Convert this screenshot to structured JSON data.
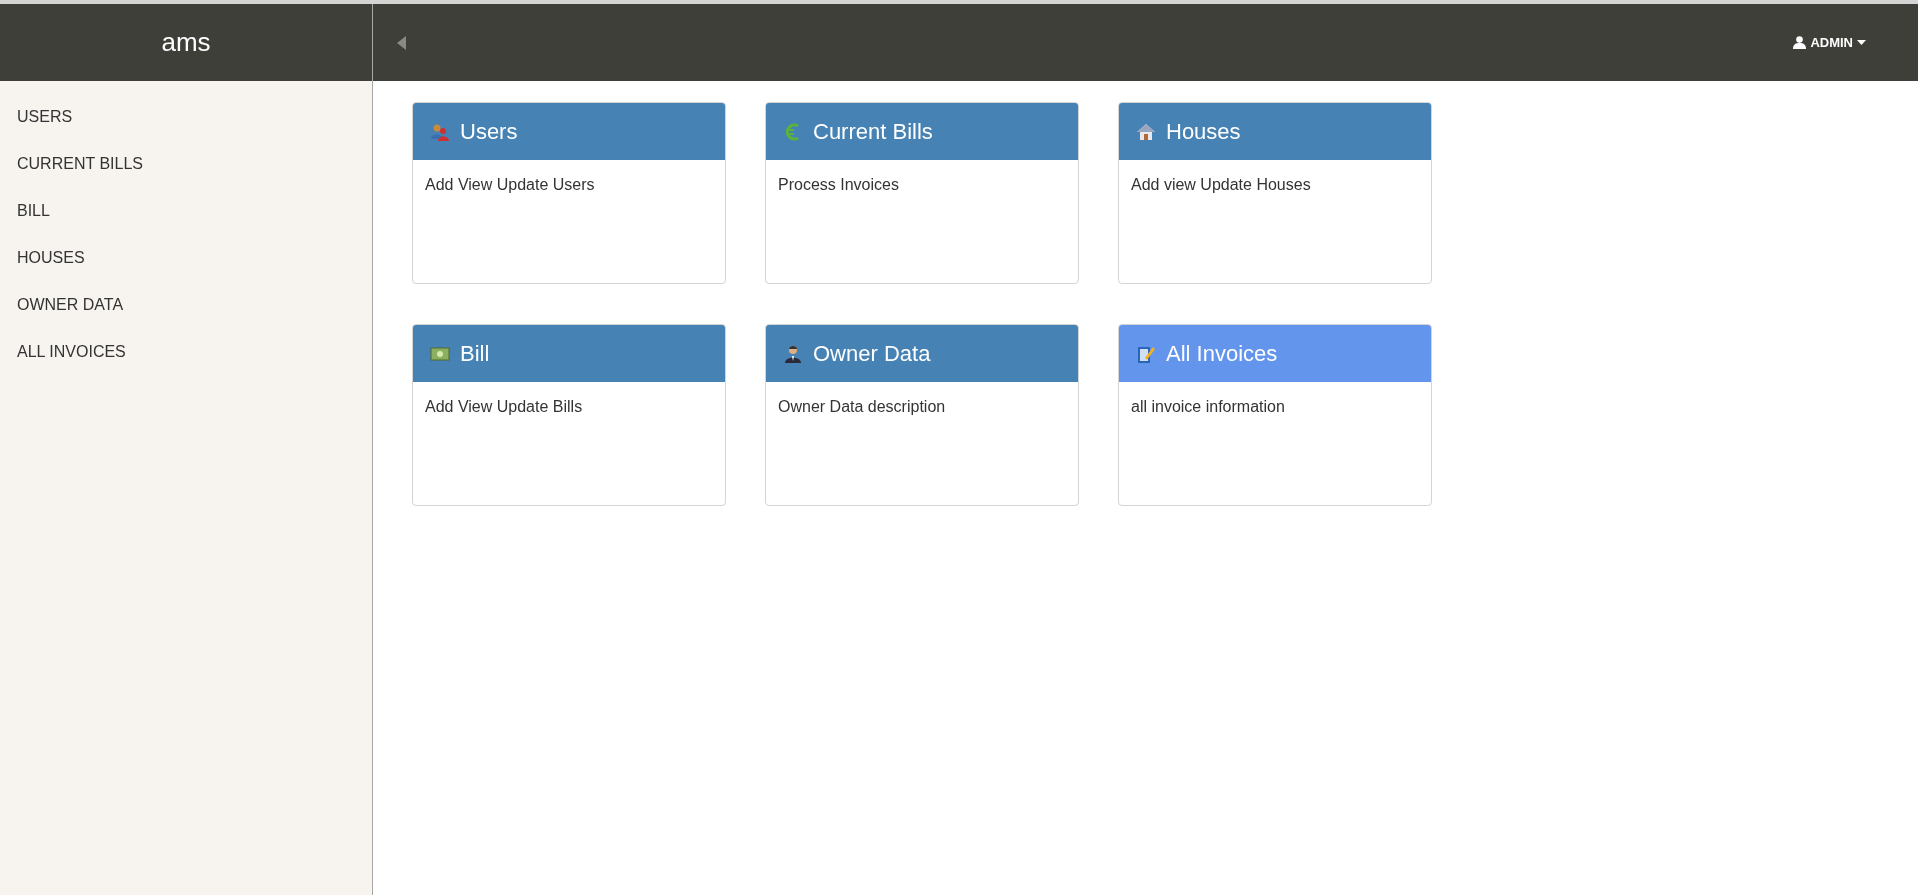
{
  "sidebar": {
    "brand": "ams",
    "items": [
      {
        "label": "USERS"
      },
      {
        "label": "CURRENT BILLS"
      },
      {
        "label": "BILL"
      },
      {
        "label": "HOUSES"
      },
      {
        "label": "OWNER DATA"
      },
      {
        "label": "ALL INVOICES"
      }
    ]
  },
  "topbar": {
    "user": "ADMIN"
  },
  "cards": [
    {
      "title": "Users",
      "description": "Add View Update Users",
      "highlighted": false
    },
    {
      "title": "Current Bills",
      "description": "Process Invoices",
      "highlighted": false
    },
    {
      "title": "Houses",
      "description": "Add view Update Houses",
      "highlighted": false
    },
    {
      "title": "Bill",
      "description": "Add View Update Bills",
      "highlighted": false
    },
    {
      "title": "Owner Data",
      "description": "Owner Data description",
      "highlighted": false
    },
    {
      "title": "All Invoices",
      "description": "all invoice information",
      "highlighted": true
    }
  ]
}
